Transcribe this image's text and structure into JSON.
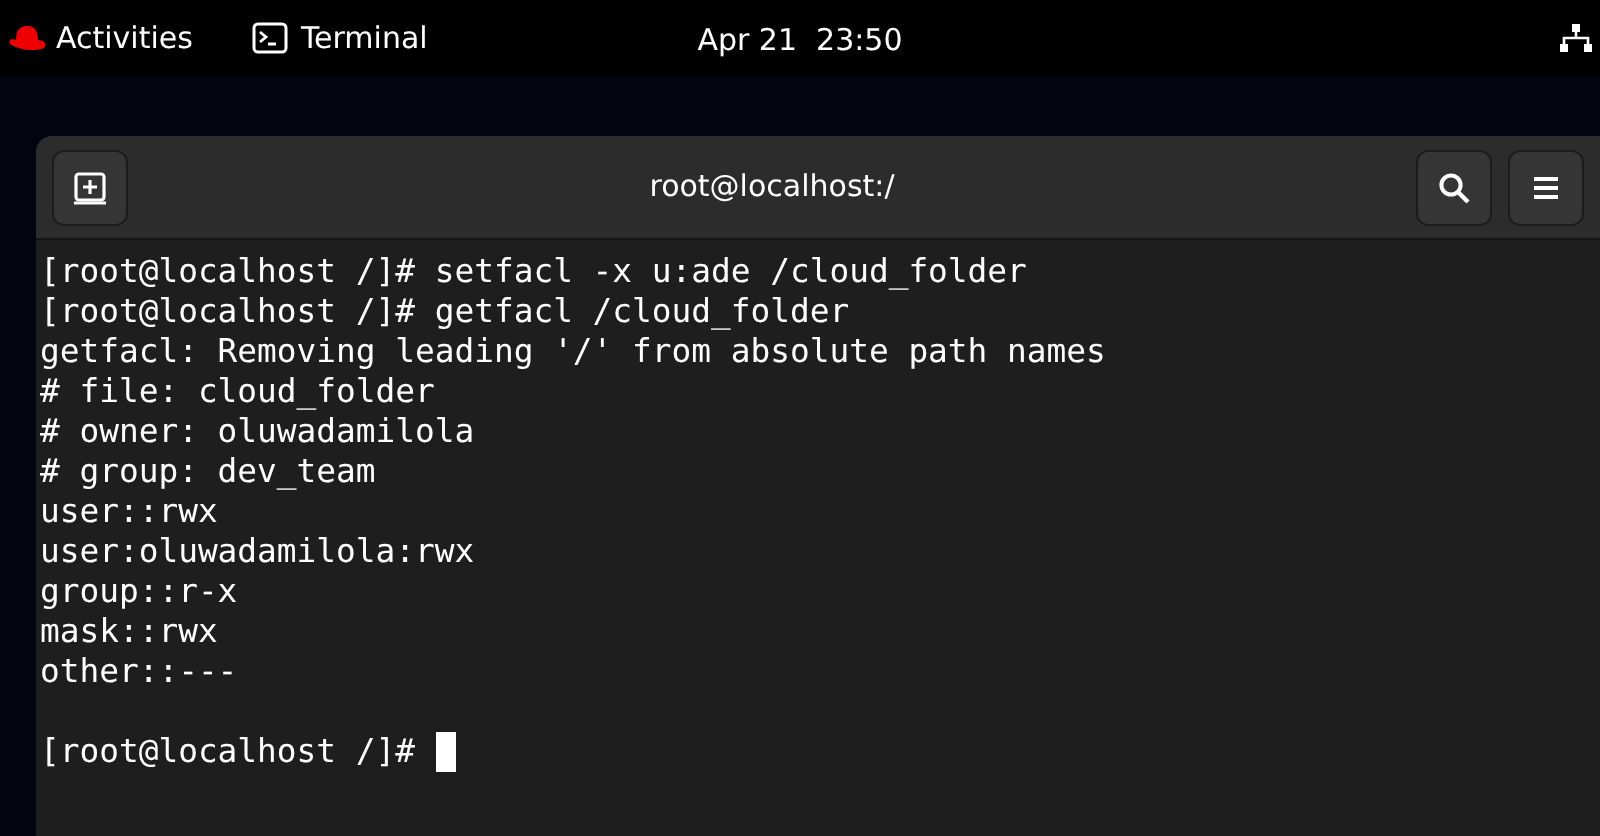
{
  "top_bar": {
    "activities": "Activities",
    "app": "Terminal",
    "clock": "Apr 21  23:50"
  },
  "window": {
    "title": "root@localhost:/"
  },
  "output": [
    "[root@localhost /]# setfacl -x u:ade /cloud_folder",
    "[root@localhost /]# getfacl /cloud_folder",
    "getfacl: Removing leading '/' from absolute path names",
    "# file: cloud_folder",
    "# owner: oluwadamilola",
    "# group: dev_team",
    "user::rwx",
    "user:oluwadamilola:rwx",
    "group::r-x",
    "mask::rwx",
    "other::---"
  ],
  "prompt": "[root@localhost /]#"
}
